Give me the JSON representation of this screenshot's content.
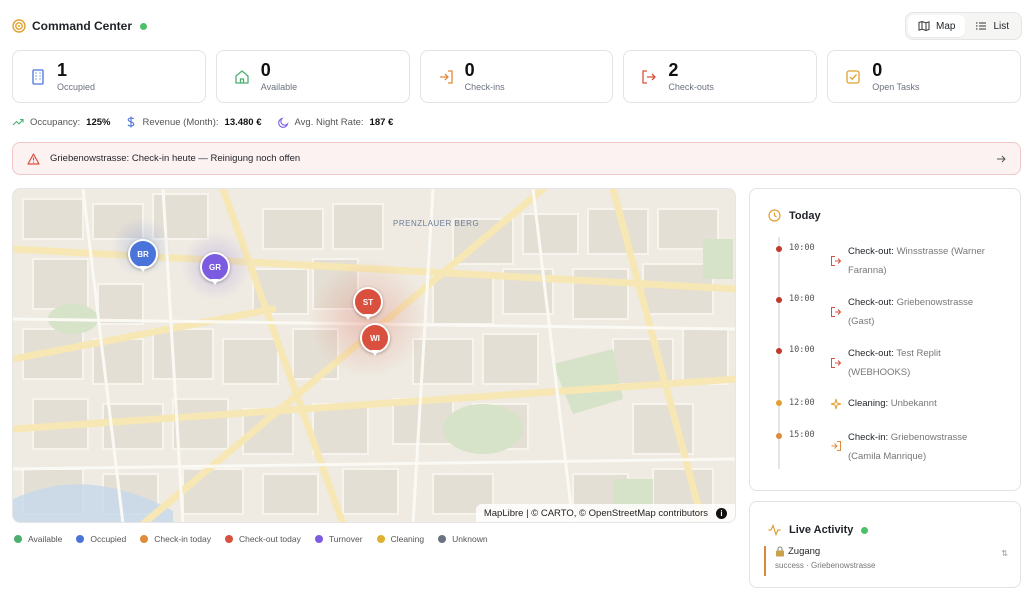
{
  "header": {
    "title": "Command Center",
    "status_color": "#4cc066"
  },
  "view_toggle": {
    "map_label": "Map",
    "list_label": "List",
    "map_icon": "map-icon",
    "list_icon": "list-icon"
  },
  "kpis": [
    {
      "value": "1",
      "label": "Occupied",
      "icon": "building-icon",
      "color": "#4a74d9"
    },
    {
      "value": "0",
      "label": "Available",
      "icon": "home-icon",
      "color": "#4caf70"
    },
    {
      "value": "0",
      "label": "Check-ins",
      "icon": "login-icon",
      "color": "#e08a3c"
    },
    {
      "value": "2",
      "label": "Check-outs",
      "icon": "logout-icon",
      "color": "#d9503e"
    },
    {
      "value": "0",
      "label": "Open Tasks",
      "icon": "checkbox-icon",
      "color": "#e0a030"
    }
  ],
  "metrics": {
    "occupancy_label": "Occupancy:",
    "occupancy_value": "125%",
    "revenue_label": "Revenue (Month):",
    "revenue_value": "13.480 €",
    "rate_label": "Avg. Night Rate:",
    "rate_value": "187 €"
  },
  "alert": {
    "text": "Griebenowstrasse: Check-in heute — Reinigung noch offen"
  },
  "map": {
    "district_label": "PRENZLAUER BERG",
    "attribution": "MapLibre | © CARTO, © OpenStreetMap contributors",
    "info_label": "i",
    "pins": [
      {
        "code": "BR",
        "color": "#4a74d9"
      },
      {
        "code": "GR",
        "color": "#7b5ce0"
      },
      {
        "code": "ST",
        "color": "#d9503e"
      },
      {
        "code": "WI",
        "color": "#d9503e"
      }
    ]
  },
  "legend": [
    {
      "label": "Available",
      "color": "#4caf70"
    },
    {
      "label": "Occupied",
      "color": "#4a74d9"
    },
    {
      "label": "Check-in today",
      "color": "#e08a3c"
    },
    {
      "label": "Check-out today",
      "color": "#d9503e"
    },
    {
      "label": "Turnover",
      "color": "#7b5ce0"
    },
    {
      "label": "Cleaning",
      "color": "#e0b030"
    },
    {
      "label": "Unknown",
      "color": "#6b7280"
    }
  ],
  "today": {
    "title": "Today",
    "events": [
      {
        "time": "10:00",
        "kind": "Check-out:",
        "detail": "Winsstrasse (Warner",
        "detail2": "Faranna)",
        "dot": "#c0392b",
        "icon": "logout-icon"
      },
      {
        "time": "10:00",
        "kind": "Check-out:",
        "detail": "Griebenowstrasse",
        "detail2": "(Gast)",
        "dot": "#c0392b",
        "icon": "logout-icon"
      },
      {
        "time": "10:00",
        "kind": "Check-out:",
        "detail": "Test Replit",
        "detail2": "(WEBHOOKS)",
        "dot": "#c0392b",
        "icon": "logout-icon"
      },
      {
        "time": "12:00",
        "kind": "Cleaning:",
        "detail": "Unbekannt",
        "detail2": "",
        "dot": "#e0a030",
        "icon": "sparkle-icon"
      },
      {
        "time": "15:00",
        "kind": "Check-in:",
        "detail": "Griebenowstrasse",
        "detail2": "(Camila Manrique)",
        "dot": "#e08a3c",
        "icon": "login-icon"
      }
    ]
  },
  "live": {
    "title": "Live Activity",
    "items": [
      {
        "title": "Zugang",
        "sub": "success · Griebenowstrasse",
        "action": "⇅",
        "icon": "lock-icon"
      }
    ]
  }
}
